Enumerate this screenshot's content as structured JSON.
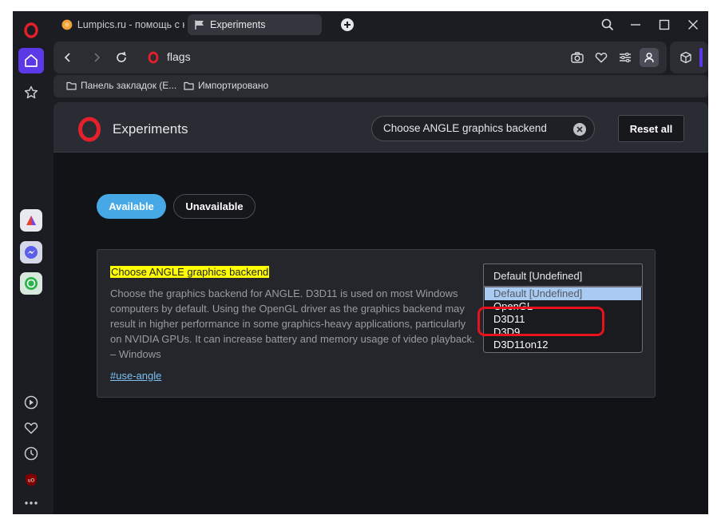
{
  "tabs": [
    {
      "title": "Lumpics.ru - помощь с ко",
      "active": false
    },
    {
      "title": "Experiments",
      "active": true
    }
  ],
  "address": {
    "url": "flags"
  },
  "bookmarks": [
    {
      "label": "Панель закладок (E..."
    },
    {
      "label": "Импортировано"
    }
  ],
  "header": {
    "title": "Experiments",
    "search_value": "Choose ANGLE graphics backend",
    "reset_label": "Reset all"
  },
  "filters": {
    "available": "Available",
    "unavailable": "Unavailable"
  },
  "experiment": {
    "title": "Choose ANGLE graphics backend",
    "description": "Choose the graphics backend for ANGLE. D3D11 is used on most Windows computers by default. Using the OpenGL driver as the graphics backend may result in higher performance in some graphics-heavy applications, particularly on NVIDIA GPUs. It can increase battery and memory usage of video playback. – Windows",
    "link": "#use-angle",
    "select_value": "Default [Undefined]",
    "options": [
      "Default [Undefined]",
      "OpenGL",
      "D3D11",
      "D3D9",
      "D3D11on12"
    ],
    "selected_option_index": 0,
    "highlighted_option": "D3D9"
  },
  "colors": {
    "accent": "#5b39e6",
    "available_pill": "#46a9e6",
    "highlight_frame": "#e8121d",
    "search_highlight": "#ffff00",
    "link": "#7dc1f2"
  }
}
